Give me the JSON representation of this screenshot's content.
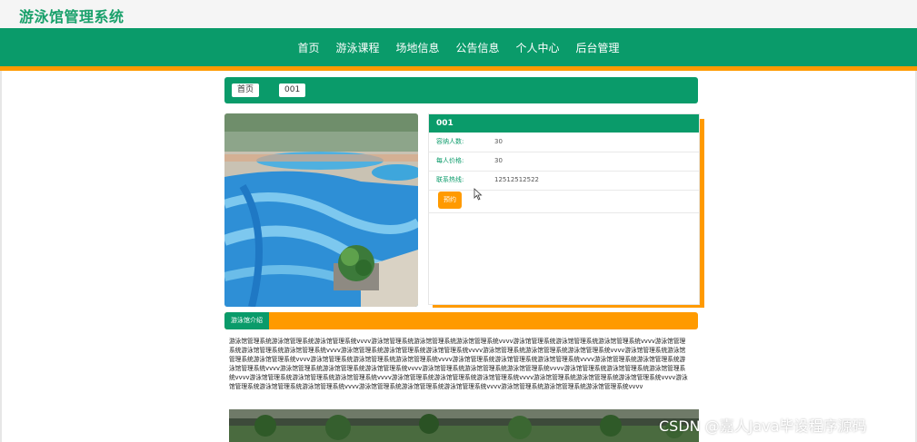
{
  "header": {
    "site_title": "游泳馆管理系统"
  },
  "nav": {
    "items": [
      {
        "label": "首页"
      },
      {
        "label": "游泳课程"
      },
      {
        "label": "场地信息"
      },
      {
        "label": "公告信息"
      },
      {
        "label": "个人中心"
      },
      {
        "label": "后台管理"
      }
    ]
  },
  "breadcrumb": {
    "home": "首页",
    "current": "001"
  },
  "detail": {
    "title": "001",
    "rows": [
      {
        "label": "容纳人数:",
        "value": "30"
      },
      {
        "label": "每人价格:",
        "value": "30"
      },
      {
        "label": "联系热线:",
        "value": "12512512522"
      }
    ],
    "book_label": "预约"
  },
  "intro": {
    "tab_label": "游泳馆介绍",
    "text": "游泳馆管理系统游泳馆管理系统游泳馆管理系统vvvv游泳馆管理系统游泳馆管理系统游泳馆管理系统vvvv游泳馆管理系统游泳馆管理系统游泳馆管理系统vvvv游泳馆管理系统游泳馆管理系统游泳馆管理系统vvvv游泳馆管理系统游泳馆管理系统游泳馆管理系统vvvv游泳馆管理系统游泳馆管理系统游泳馆管理系统vvvv游泳馆管理系统游泳馆管理系统游泳馆管理系统vvvv游泳馆管理系统游泳馆管理系统游泳馆管理系统vvvv游泳馆管理系统游泳馆管理系统游泳馆管理系统vvvv游泳馆管理系统游泳馆管理系统游泳馆管理系统vvvv游泳馆管理系统游泳馆管理系统游泳馆管理系统vvvv游泳馆管理系统游泳馆管理系统游泳馆管理系统vvvv游泳馆管理系统游泳馆管理系统游泳馆管理系统vvvv游泳馆管理系统游泳馆管理系统游泳馆管理系统vvvv游泳馆管理系统游泳馆管理系统游泳馆管理系统vvvv游泳馆管理系统游泳馆管理系统游泳馆管理系统vvvv游泳馆管理系统游泳馆管理系统游泳馆管理系统vvvv游泳馆管理系统游泳馆管理系统游泳馆管理系统vvvv游泳馆管理系统游泳馆管理系统游泳馆管理系统vvvv"
  },
  "watermark": "CSDN @嘉人Java毕设程序源码",
  "colors": {
    "primary": "#0a9b6a",
    "accent": "#ff9a00",
    "title": "#18a06a"
  }
}
